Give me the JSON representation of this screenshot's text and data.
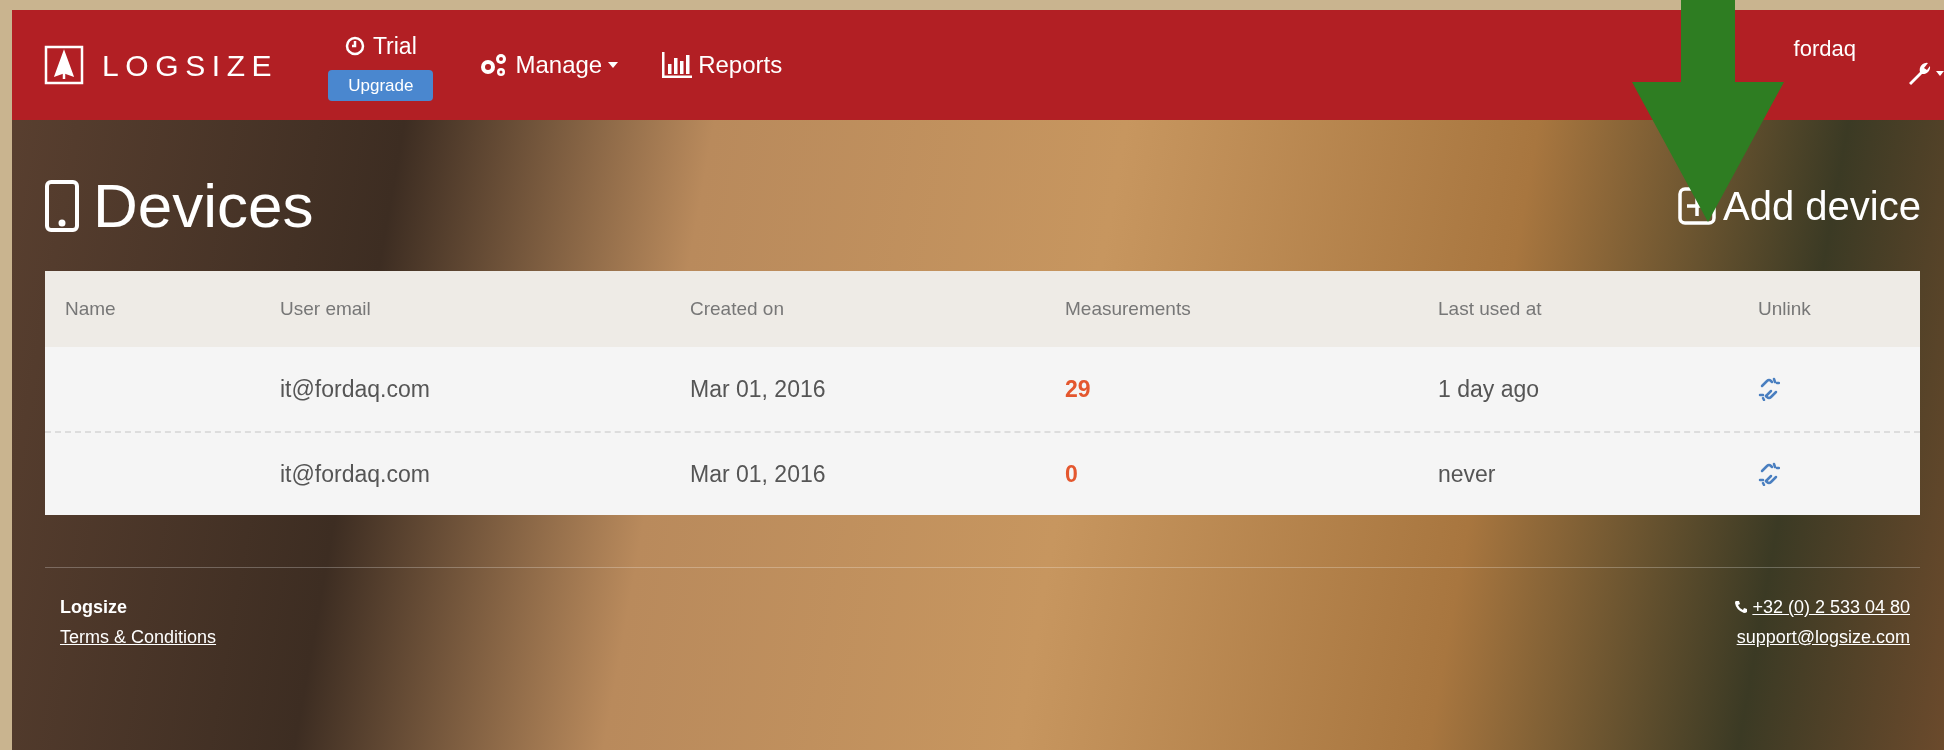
{
  "navbar": {
    "brand": "LOGSIZE",
    "trial": "Trial",
    "upgrade": "Upgrade",
    "menu": [
      {
        "kind": "dropdown",
        "label": "Manage"
      },
      {
        "kind": "link",
        "label": "Reports"
      }
    ],
    "user": "fordaq"
  },
  "page": {
    "title": "Devices",
    "add_button": "Add device"
  },
  "table": {
    "columns": [
      "Name",
      "User email",
      "Created on",
      "Measurements",
      "Last used at",
      "Unlink"
    ],
    "rows": [
      {
        "name": "",
        "email": "it@fordaq.com",
        "created": "Mar 01, 2016",
        "measurements": "29",
        "last_used": "1 day ago"
      },
      {
        "name": "",
        "email": "it@fordaq.com",
        "created": "Mar 01, 2016",
        "measurements": "0",
        "last_used": "never"
      }
    ]
  },
  "footer": {
    "company": "Logsize",
    "terms": "Terms & Conditions",
    "phone": "+32 (0) 2 533 04 80",
    "email": "support@logsize.com"
  }
}
